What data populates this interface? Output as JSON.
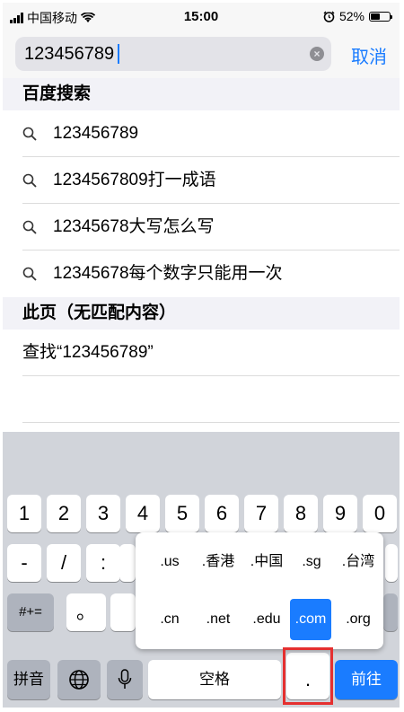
{
  "status": {
    "carrier": "中国移动",
    "time": "15:00",
    "battery_text": "52%",
    "battery_level": 0.52
  },
  "search": {
    "value": "123456789",
    "cancel_label": "取消",
    "clear_glyph": "×"
  },
  "baidu": {
    "header": "百度搜索",
    "suggestions": [
      "123456789",
      "1234567809打一成语",
      "12345678大写怎么写",
      "12345678每个数字只能用一次"
    ]
  },
  "page": {
    "header": "此页（无匹配内容）",
    "find_label": "查找“123456789”"
  },
  "keyboard": {
    "row1": [
      "1",
      "2",
      "3",
      "4",
      "5",
      "6",
      "7",
      "8",
      "9",
      "0"
    ],
    "row2": [
      "-",
      "/",
      ":"
    ],
    "symbols_label": "#+=",
    "circle_key": "。",
    "pinyin_label": "拼音",
    "space_label": "空格",
    "dot_label": ".",
    "go_label": "前往",
    "domains_row1": [
      ".us",
      ".香港",
      ".中国",
      ".sg",
      ".台湾"
    ],
    "domains_row2": [
      ".cn",
      ".net",
      ".edu",
      ".com",
      ".org"
    ],
    "selected_domain": ".com"
  },
  "colors": {
    "accent": "#1a7cff",
    "highlight": "#e53030"
  }
}
